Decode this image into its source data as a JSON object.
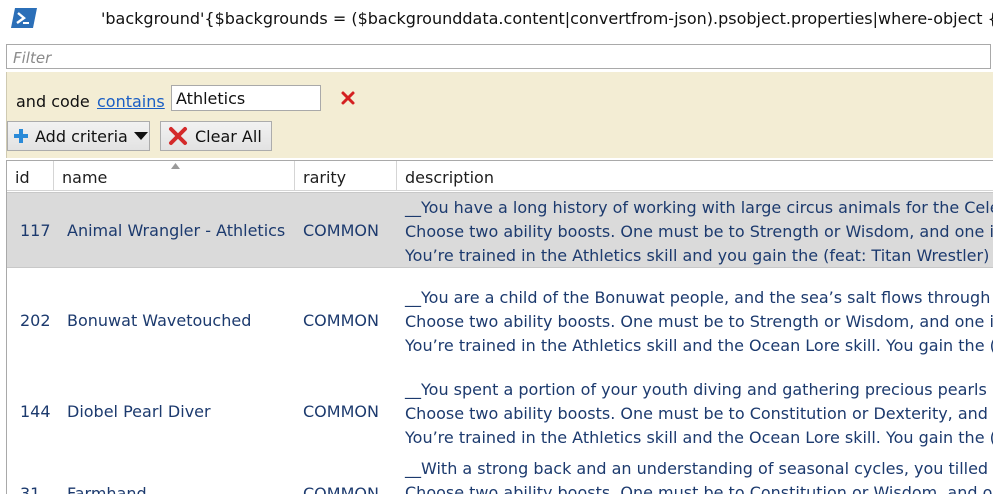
{
  "window": {
    "title": "'background'{$backgrounds = ($backgrounddata.content|convertfrom-json).psobject.properties|where-object {$_"
  },
  "filter": {
    "placeholder": "Filter",
    "value": ""
  },
  "criteria": {
    "label": "and code",
    "operator": "contains",
    "value": "Athletics",
    "add_label": "Add criteria",
    "clear_label": "Clear All"
  },
  "grid": {
    "columns": [
      "id",
      "name",
      "rarity",
      "description"
    ],
    "sorted_column": "name",
    "rows": [
      {
        "id": "117",
        "name": "Animal Wrangler - Athletics",
        "rarity": "COMMON",
        "desc": [
          "__You have a long history of working with large circus animals for the Celestial",
          "Choose two ability boosts. One must be to Strength or Wisdom, and one is a free",
          "You’re trained in the Athletics skill and you gain the (feat: Titan Wrestler) skill feat."
        ],
        "selected": true
      },
      {
        "id": "202",
        "name": "Bonuwat Wavetouched",
        "rarity": "COMMON",
        "desc": [
          "__You are a child of the Bonuwat people, and the sea’s salt flows through your veins",
          "Choose two ability boosts. One must be to Strength or Wisdom, and one is a free",
          "You’re trained in the Athletics skill and the Ocean Lore skill. You gain the (feat"
        ],
        "selected": false
      },
      {
        "id": "144",
        "name": "Diobel Pearl Diver",
        "rarity": "COMMON",
        "desc": [
          "__You spent a portion of your youth diving and gathering precious pearls underwater",
          "Choose two ability boosts. One must be to Constitution or Dexterity, and one is free",
          "You’re trained in the Athletics skill and the Ocean Lore skill. You gain the (feat"
        ],
        "selected": false
      },
      {
        "id": "31",
        "name": "Farmhand",
        "rarity": "COMMON",
        "desc": [
          "__With a strong back and an understanding of seasonal cycles, you tilled the land",
          "Choose two ability boosts. One must be to Constitution or Wisdom, and one is free"
        ],
        "selected": false
      }
    ]
  }
}
